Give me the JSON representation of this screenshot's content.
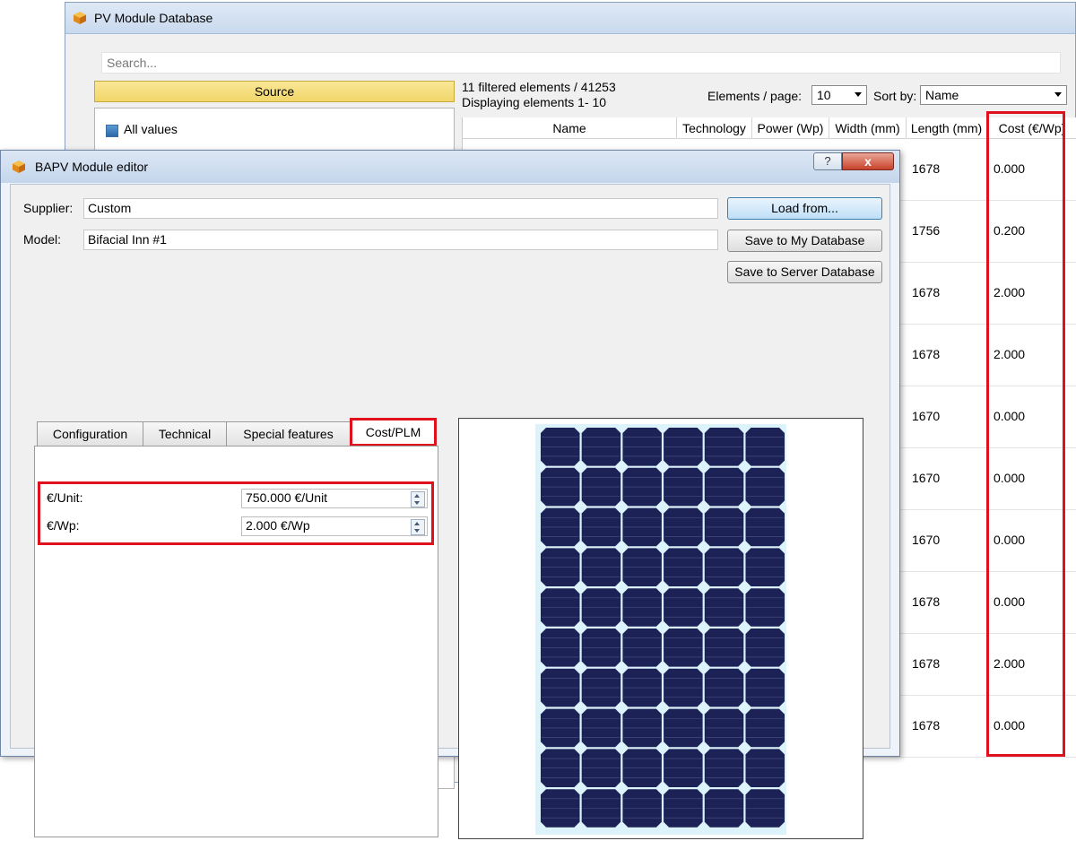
{
  "db_window": {
    "title": "PV Module Database",
    "search_placeholder": "Search...",
    "source_label": "Source",
    "all_values_label": "All values",
    "filter_info_line1": "11 filtered elements / 41253",
    "filter_info_line2": "Displaying elements 1- 10",
    "elements_per_page_label": "Elements / page:",
    "elements_per_page_value": "10",
    "sort_by_label": "Sort by:",
    "sort_by_value": "Name",
    "table": {
      "headers": [
        "Name",
        "Technology",
        "Power (Wp)",
        "Width (mm)",
        "Length (mm)",
        "Cost (€/Wp)"
      ],
      "rows": [
        {
          "length": "1678",
          "cost": "0.000"
        },
        {
          "length": "1756",
          "cost": "0.200"
        },
        {
          "length": "1678",
          "cost": "2.000"
        },
        {
          "length": "1678",
          "cost": "2.000"
        },
        {
          "length": "1670",
          "cost": "0.000"
        },
        {
          "length": "1670",
          "cost": "0.000"
        },
        {
          "length": "1670",
          "cost": "0.000"
        },
        {
          "length": "1678",
          "cost": "0.000"
        },
        {
          "length": "1678",
          "cost": "2.000"
        },
        {
          "length": "1678",
          "cost": "0.000"
        }
      ]
    }
  },
  "editor": {
    "title": "BAPV Module editor",
    "help_label": "?",
    "close_label": "x",
    "supplier_label": "Supplier:",
    "supplier_value": "Custom",
    "model_label": "Model:",
    "model_value": "Bifacial Inn #1",
    "buttons": {
      "load_from": "Load from...",
      "save_my_db": "Save to My Database",
      "save_server_db": "Save to Server Database"
    },
    "tabs": [
      "Configuration",
      "Technical",
      "Special features",
      "Cost/PLM"
    ],
    "active_tab": "Cost/PLM",
    "cost_fields": [
      {
        "label": "€/Unit:",
        "value": "750.000 €/Unit"
      },
      {
        "label": "€/Wp:",
        "value": "2.000 €/Wp"
      }
    ]
  },
  "colors": {
    "highlight": "#e0101c",
    "cell_color": "#1c2255",
    "panel_bg": "#dcf3fc"
  },
  "icons": [
    "app-cube-icon",
    "checkbox-checked-icon",
    "dropdown-arrow-icon",
    "spinner-icon",
    "solar-panel-preview"
  ]
}
